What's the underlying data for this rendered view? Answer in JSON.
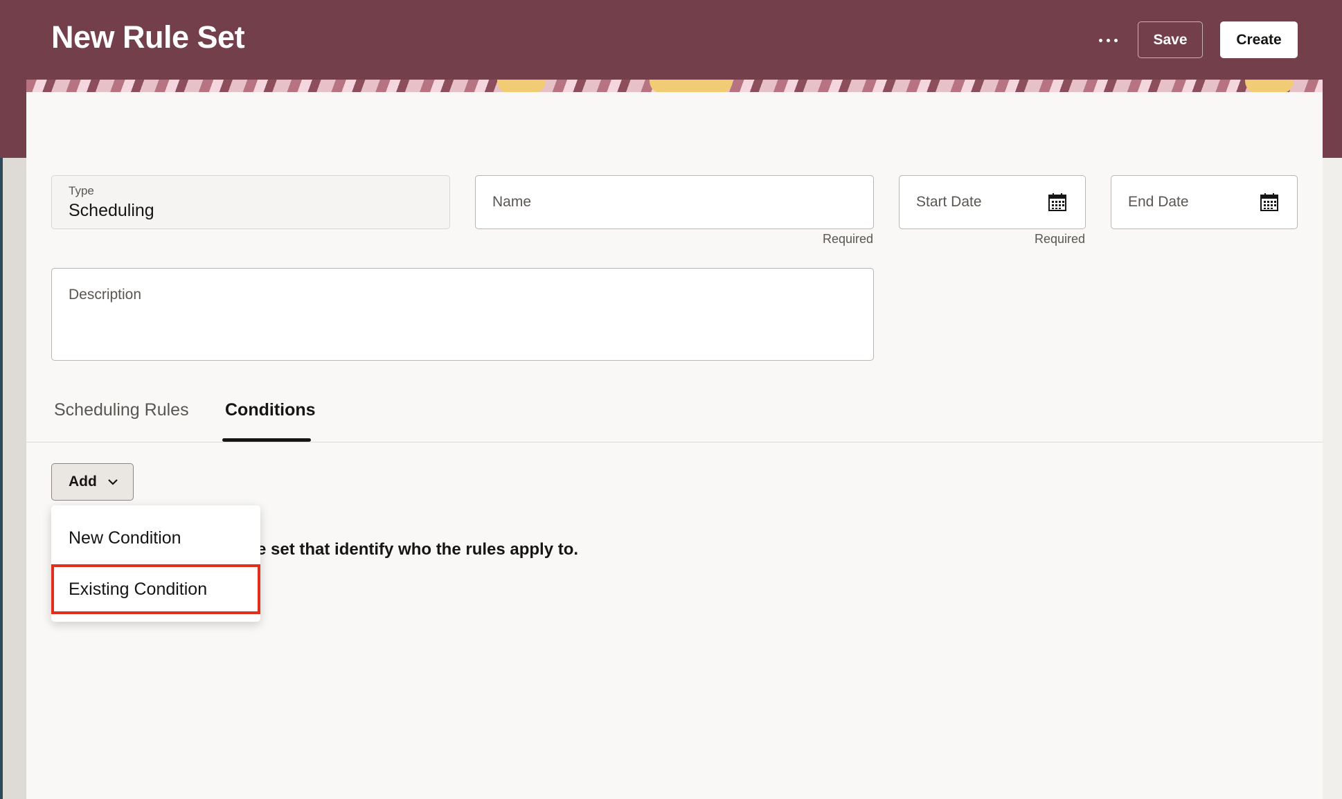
{
  "header": {
    "title": "New Rule Set",
    "more_icon": "more-horizontal-icon",
    "save_label": "Save",
    "create_label": "Create"
  },
  "form": {
    "type": {
      "label": "Type",
      "value": "Scheduling"
    },
    "name": {
      "placeholder": "Name",
      "hint": "Required"
    },
    "start_date": {
      "placeholder": "Start Date",
      "hint": "Required",
      "icon": "calendar-icon"
    },
    "end_date": {
      "placeholder": "End Date",
      "icon": "calendar-icon"
    },
    "description": {
      "placeholder": "Description"
    }
  },
  "tabs": [
    {
      "label": "Scheduling Rules",
      "active": false
    },
    {
      "label": "Conditions",
      "active": true
    }
  ],
  "conditions": {
    "add_label": "Add",
    "add_icon": "chevron-down-icon",
    "empty_text_visible": "e set that identify who the rules apply to.",
    "menu": [
      {
        "label": "New Condition"
      },
      {
        "label": "Existing Condition",
        "highlighted": true
      }
    ]
  },
  "colors": {
    "header": "#723f4b",
    "highlight": "#e02f1d",
    "card": "#f9f8f6"
  }
}
